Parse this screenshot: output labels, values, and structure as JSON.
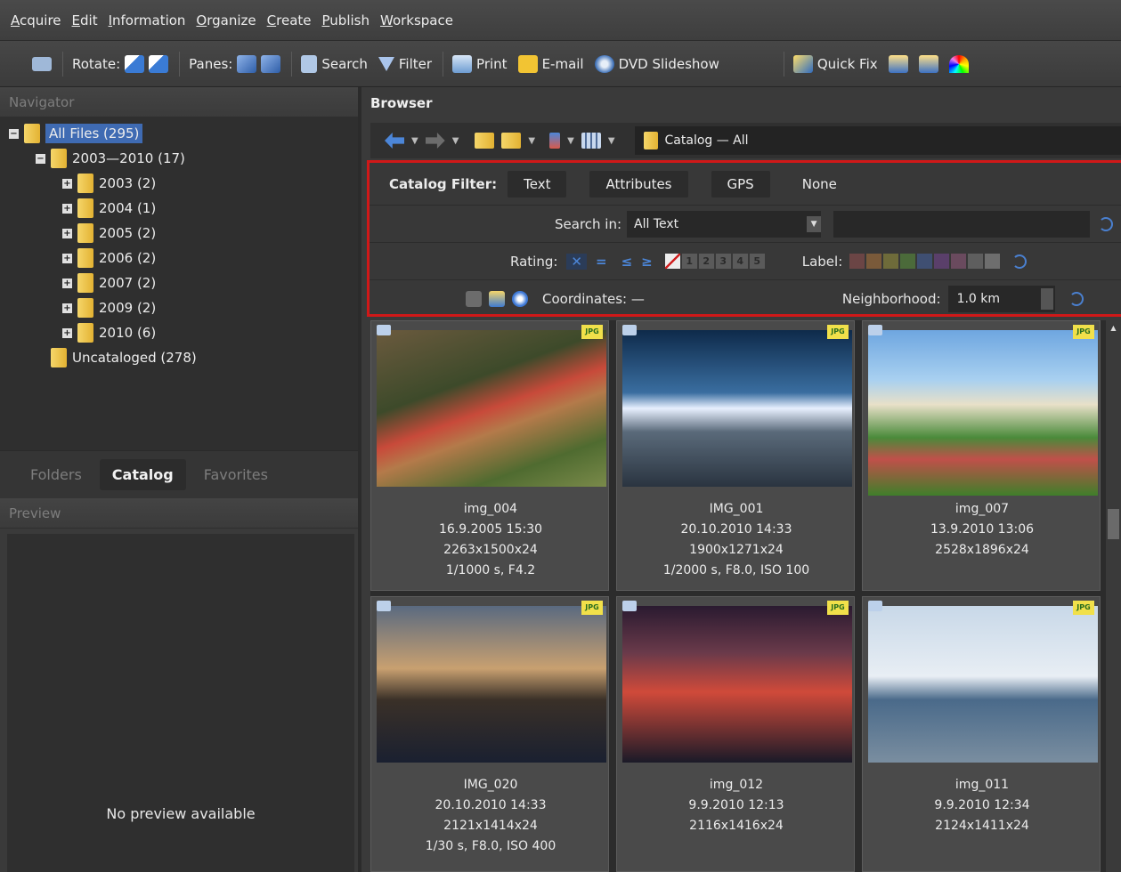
{
  "menu": [
    {
      "ul": "A",
      "rest": "cquire"
    },
    {
      "ul": "E",
      "rest": "dit"
    },
    {
      "ul": "I",
      "rest": "nformation"
    },
    {
      "ul": "O",
      "rest": "rganize"
    },
    {
      "ul": "C",
      "rest": "reate"
    },
    {
      "ul": "P",
      "rest": "ublish"
    },
    {
      "ul": "W",
      "rest": "orkspace"
    }
  ],
  "toolbar": {
    "rotate_label": "Rotate:",
    "panes_label": "Panes:",
    "search_label": "Search",
    "filter_label": "Filter",
    "print_label": "Print",
    "email_label": "E-mail",
    "dvd_label": "DVD Slideshow",
    "quickfix_label": "Quick Fix"
  },
  "navigator": {
    "title": "Navigator",
    "tree": [
      {
        "label": "All Files (295)",
        "level": 0,
        "expander": "−",
        "selected": true
      },
      {
        "label": "2003—2010 (17)",
        "level": 1,
        "expander": "−"
      },
      {
        "label": "2003 (2)",
        "level": 2,
        "expander": "+"
      },
      {
        "label": "2004 (1)",
        "level": 2,
        "expander": "+"
      },
      {
        "label": "2005 (2)",
        "level": 2,
        "expander": "+"
      },
      {
        "label": "2006 (2)",
        "level": 2,
        "expander": "+"
      },
      {
        "label": "2007 (2)",
        "level": 2,
        "expander": "+"
      },
      {
        "label": "2009 (2)",
        "level": 2,
        "expander": "+"
      },
      {
        "label": "2010 (6)",
        "level": 2,
        "expander": "+"
      },
      {
        "label": "Uncataloged (278)",
        "level": 1,
        "expander": ""
      }
    ],
    "tabs": [
      "Folders",
      "Catalog",
      "Favorites"
    ],
    "active_tab": "Catalog"
  },
  "preview": {
    "title": "Preview",
    "empty_text": "No preview available"
  },
  "browser": {
    "title": "Browser",
    "path": "Catalog — All"
  },
  "filter": {
    "label": "Catalog Filter:",
    "buttons": [
      "Text",
      "Attributes",
      "GPS"
    ],
    "none_label": "None",
    "search_in_label": "Search in:",
    "search_in_value": "All Text",
    "rating_label": "Rating:",
    "rating_x": "✕",
    "rating_eq": "=",
    "rating_le": "≤",
    "rating_ge": "≥",
    "rating_levels": [
      "1",
      "2",
      "3",
      "4",
      "5"
    ],
    "label_label": "Label:",
    "label_colors": [
      "#6b4545",
      "#7a5a3a",
      "#6e6b3a",
      "#4b6a3a",
      "#3f4f72",
      "#5a3f6a",
      "#6a4a5e",
      "#5e5e5e",
      "#6e6e6e"
    ],
    "coordinates_label": "Coordinates: —",
    "neighborhood_label": "Neighborhood:",
    "neighborhood_value": "1.0 km"
  },
  "thumbnails": [
    {
      "name": "img_004",
      "date": "16.9.2005 15:30",
      "size": "2263x1500x24",
      "exif": "1/1000 s, F4.2",
      "badge": "JPG"
    },
    {
      "name": "IMG_001",
      "date": "20.10.2010 14:33",
      "size": "1900x1271x24",
      "exif": "1/2000 s, F8.0, ISO 100",
      "badge": "JPG"
    },
    {
      "name": "img_007",
      "date": "13.9.2010 13:06",
      "size": "2528x1896x24",
      "exif": "",
      "badge": "JPG"
    },
    {
      "name": "IMG_020",
      "date": "20.10.2010 14:33",
      "size": "2121x1414x24",
      "exif": "1/30 s, F8.0, ISO 400",
      "badge": "JPG"
    },
    {
      "name": "img_012",
      "date": "9.9.2010 12:13",
      "size": "2116x1416x24",
      "exif": "",
      "badge": "JPG"
    },
    {
      "name": "img_011",
      "date": "9.9.2010 12:34",
      "size": "2124x1411x24",
      "exif": "",
      "badge": "JPG"
    }
  ]
}
